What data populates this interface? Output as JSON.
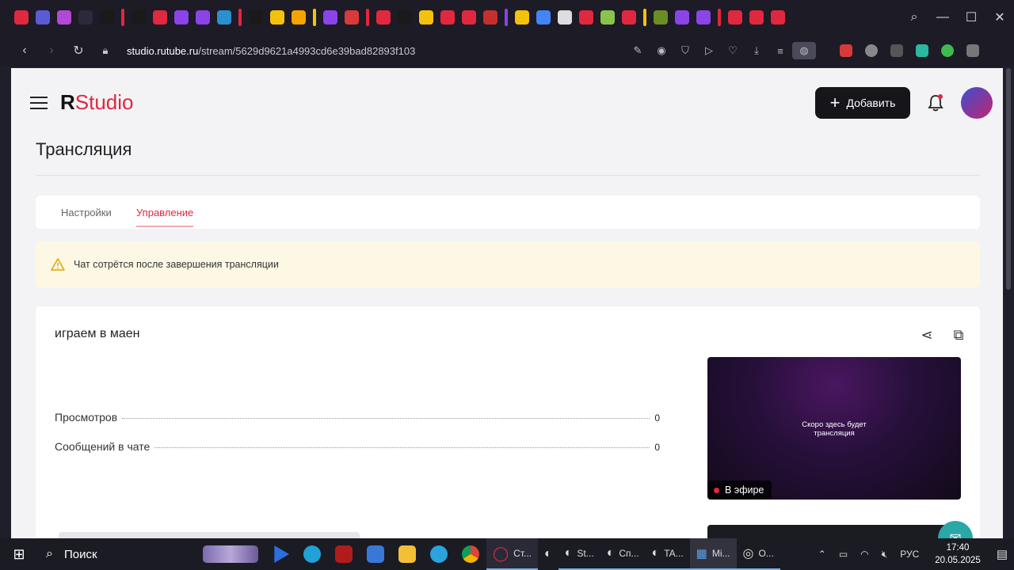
{
  "browser": {
    "url_host": "studio.rutube.ru",
    "url_path": "/stream/5629d9621a4993cd6e39bad82893f103",
    "tab_icon_colors": [
      "#e0283f",
      "#5b5bd6",
      "#b04ad6",
      "#2a2a3a",
      "#1a1a1a",
      "#1a1a1a",
      "#e0283f",
      "#8a44e8",
      "#8a44e8",
      "#2a90d0",
      "#1a1a1a",
      "#f4c20d",
      "#f4a300",
      "#8a44e8",
      "#d83a3a",
      "#e0283f",
      "#1a1a1a",
      "#f4c20d",
      "#e0283f",
      "#e0283f",
      "#c43030",
      "#f4c20d",
      "#4285f4",
      "#ddd",
      "#e0283f",
      "#8bc34a",
      "#e0283f",
      "#6b8e23",
      "#8a44e8",
      "#8a44e8",
      "#e0283f",
      "#e0283f",
      "#e0283f"
    ]
  },
  "header": {
    "logo_r": "R",
    "logo_studio": "Studio",
    "add_button_label": "Добавить"
  },
  "page": {
    "title": "Трансляция",
    "tabs": [
      {
        "label": "Настройки",
        "active": false
      },
      {
        "label": "Управление",
        "active": true
      }
    ],
    "warning_text": "Чат сотрётся после завершения трансляции"
  },
  "stream": {
    "title": "играем в маен",
    "stats": [
      {
        "label": "Просмотров",
        "value": "0"
      },
      {
        "label": "Сообщений в чате",
        "value": "0"
      }
    ],
    "preview_line1": "Скоро здесь будет",
    "preview_line2": "трансляция",
    "live_label": "В эфире"
  },
  "taskbar": {
    "search_label": "Поиск",
    "apps": [
      "Ст...",
      "St...",
      "Сп...",
      "TA...",
      "Mi...",
      "O..."
    ],
    "language": "РУС",
    "time": "17:40",
    "date": "20.05.2025"
  }
}
